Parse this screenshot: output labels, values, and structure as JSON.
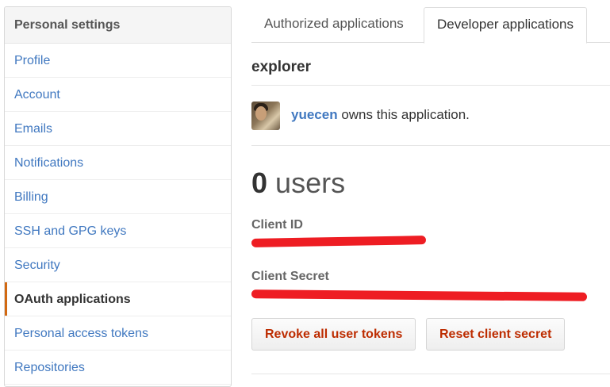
{
  "sidebar": {
    "header": "Personal settings",
    "items": [
      {
        "label": "Profile"
      },
      {
        "label": "Account"
      },
      {
        "label": "Emails"
      },
      {
        "label": "Notifications"
      },
      {
        "label": "Billing"
      },
      {
        "label": "SSH and GPG keys"
      },
      {
        "label": "Security"
      },
      {
        "label": "OAuth applications",
        "selected": true
      },
      {
        "label": "Personal access tokens"
      },
      {
        "label": "Repositories"
      }
    ]
  },
  "tabs": [
    {
      "label": "Authorized applications"
    },
    {
      "label": "Developer applications",
      "selected": true
    }
  ],
  "app": {
    "name": "explorer",
    "owner": {
      "username": "yuecen",
      "suffix": " owns this application."
    },
    "users": {
      "count": "0",
      "unit": "users"
    },
    "client_id": {
      "label": "Client ID"
    },
    "client_secret": {
      "label": "Client Secret"
    },
    "buttons": {
      "revoke": "Revoke all user tokens",
      "reset": "Reset client secret"
    }
  },
  "colors": {
    "link": "#4078c0",
    "accent": "#d26911",
    "danger": "#bd2c00",
    "redaction": "#ee1d23"
  }
}
